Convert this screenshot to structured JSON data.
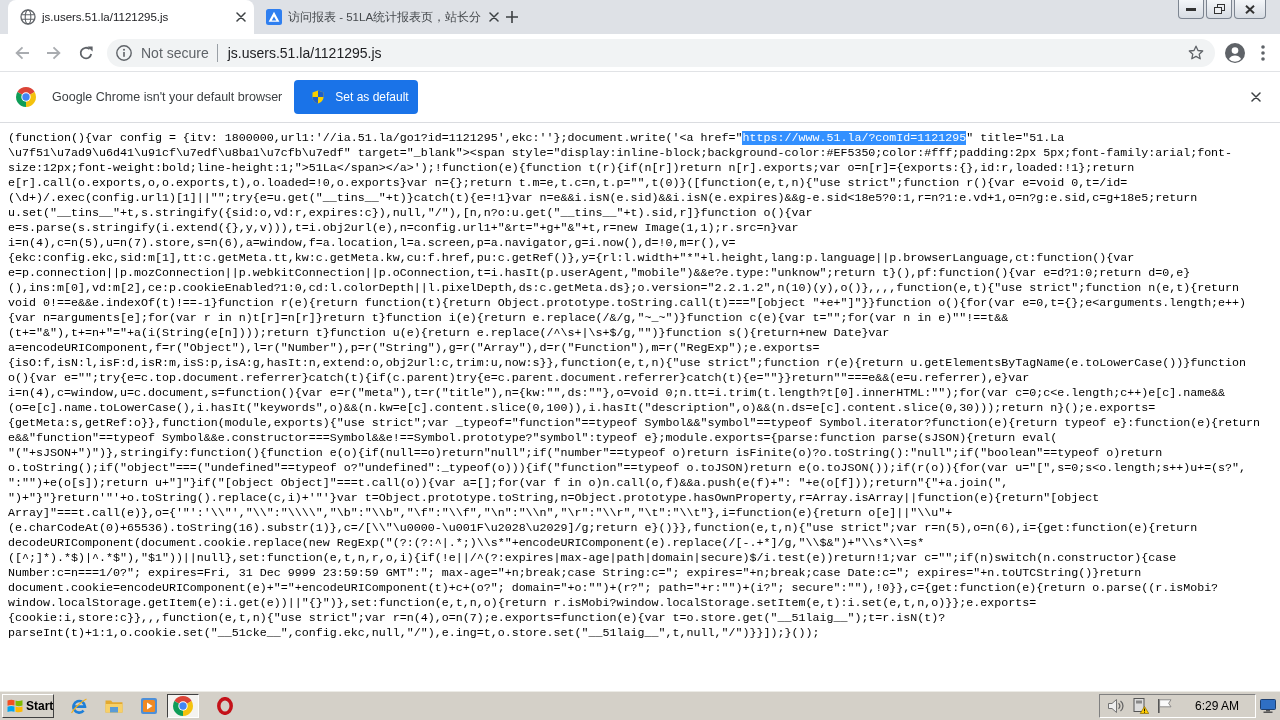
{
  "browser": {
    "tabs": [
      {
        "title": "js.users.51.la/1121295.js",
        "selected": true
      },
      {
        "title": "访问报表 - 51LA统计报表页，站长分",
        "selected": false
      }
    ]
  },
  "toolbar": {
    "security_label": "Not secure",
    "url": "js.users.51.la/1121295.js"
  },
  "infobar": {
    "message": "Google Chrome isn't your default browser",
    "button": "Set as default"
  },
  "document": {
    "lines": [
      {
        "segments": [
          {
            "text": "(function(){var config = {itv: 1800000,url1:'//ia.51.la/go1?id=1121295',ekc:''};document.write('<a href=\"",
            "selected": false
          },
          {
            "text": "https://www.51.la/?comId=1121295",
            "selected": true
          },
          {
            "text": "\" title=\"51.La",
            "selected": false
          }
        ]
      },
      {
        "segments": [
          {
            "text": "\\u7f51\\u7ad9\\u6d41\\u91cf\\u7edf\\u8ba1\\u7cfb\\u7edf\" target=\"_blank\"><span style=\"display:inline-block;background-color:#EF5350;color:#fff;padding:2px 5px;font-family:arial;font-",
            "selected": false
          }
        ]
      },
      {
        "segments": [
          {
            "text": "size:12px;font-weight:bold;line-height:1;\">51La</span></a>');!function(e){function t(r){if(n[r])return n[r].exports;var o=n[r]={exports:{},id:r,loaded:!1};return",
            "selected": false
          }
        ]
      },
      {
        "segments": [
          {
            "text": "e[r].call(o.exports,o,o.exports,t),o.loaded=!0,o.exports}var n={};return t.m=e,t.c=n,t.p=\"\",t(0)}([function(e,t,n){\"use strict\";function r(){var e=void 0,t=/id=",
            "selected": false
          }
        ]
      },
      {
        "segments": [
          {
            "text": "(\\d+)/.exec(config.url1)[1]||\"\";try{e=u.get(\"__tins__\"+t)}catch(t){e=!1}var n=e&&i.isN(e.sid)&&i.isN(e.expires)&&g-e.sid<18e5?0:1,r=n?1:e.vd+1,o=n?g:e.sid,c=g+18e5;return",
            "selected": false
          }
        ]
      },
      {
        "segments": [
          {
            "text": "u.set(\"__tins__\"+t,s.stringify({sid:o,vd:r,expires:c}),null,\"/\"),[n,n?o:u.get(\"__tins__\"+t).sid,r]}function o(){var",
            "selected": false
          }
        ]
      },
      {
        "segments": [
          {
            "text": "e=s.parse(s.stringify(i.extend({},y,v))),t=i.obj2url(e),n=config.url1+\"&rt=\"+g+\"&\"+t,r=new Image(1,1);r.src=n}var",
            "selected": false
          }
        ]
      },
      {
        "segments": [
          {
            "text": "i=n(4),c=n(5),u=n(7).store,s=n(6),a=window,f=a.location,l=a.screen,p=a.navigator,g=i.now(),d=!0,m=r(),v=",
            "selected": false
          }
        ]
      },
      {
        "segments": [
          {
            "text": "{ekc:config.ekc,sid:m[1],tt:c.getMeta.tt,kw:c.getMeta.kw,cu:f.href,pu:c.getRef()},y={rl:l.width+\"*\"+l.height,lang:p.language||p.browserLanguage,ct:function(){var",
            "selected": false
          }
        ]
      },
      {
        "segments": [
          {
            "text": "e=p.connection||p.mozConnection||p.webkitConnection||p.oConnection,t=i.hasIt(p.userAgent,\"mobile\")&&e?e.type:\"unknow\";return t}(),pf:function(){var e=d?1:0;return d=0,e}",
            "selected": false
          }
        ]
      },
      {
        "segments": [
          {
            "text": "(),ins:m[0],vd:m[2],ce:p.cookieEnabled?1:0,cd:l.colorDepth||l.pixelDepth,ds:c.getMeta.ds};o.version=\"2.2.1.2\",n(10)(y),o()},,,,function(e,t){\"use strict\";function n(e,t){return",
            "selected": false
          }
        ]
      },
      {
        "segments": [
          {
            "text": "void 0!==e&&e.indexOf(t)!==-1}function r(e){return function(t){return Object.prototype.toString.call(t)===\"[object \"+e+\"]\"}}function o(){for(var e=0,t={};e<arguments.length;e++)",
            "selected": false
          }
        ]
      },
      {
        "segments": [
          {
            "text": "{var n=arguments[e];for(var r in n)t[r]=n[r]}return t}function i(e){return e.replace(/&/g,\"~_~\")}function c(e){var t=\"\";for(var n in e)\"\"!==t&&",
            "selected": false
          }
        ]
      },
      {
        "segments": [
          {
            "text": "(t+=\"&\"),t+=n+\"=\"+a(i(String(e[n])));return t}function u(e){return e.replace(/^\\s+|\\s+$/g,\"\")}function s(){return+new Date}var",
            "selected": false
          }
        ]
      },
      {
        "segments": [
          {
            "text": "a=encodeURIComponent,f=r(\"Object\"),l=r(\"Number\"),p=r(\"String\"),g=r(\"Array\"),d=r(\"Function\"),m=r(\"RegExp\");e.exports=",
            "selected": false
          }
        ]
      },
      {
        "segments": [
          {
            "text": "{isO:f,isN:l,isF:d,isR:m,isS:p,isA:g,hasIt:n,extend:o,obj2url:c,trim:u,now:s}},function(e,t,n){\"use strict\";function r(e){return u.getElementsByTagName(e.toLowerCase())}function",
            "selected": false
          }
        ]
      },
      {
        "segments": [
          {
            "text": "o(){var e=\"\";try{e=c.top.document.referrer}catch(t){if(c.parent)try{e=c.parent.document.referrer}catch(t){e=\"\"}}return\"\"===e&&(e=u.referrer),e}var",
            "selected": false
          }
        ]
      },
      {
        "segments": [
          {
            "text": "i=n(4),c=window,u=c.document,s=function(){var e=r(\"meta\"),t=r(\"title\"),n={kw:\"\",ds:\"\"},o=void 0;n.tt=i.trim(t.length?t[0].innerHTML:\"\");for(var c=0;c<e.length;c++)e[c].name&&",
            "selected": false
          }
        ]
      },
      {
        "segments": [
          {
            "text": "(o=e[c].name.toLowerCase(),i.hasIt(\"keywords\",o)&&(n.kw=e[c].content.slice(0,100)),i.hasIt(\"description\",o)&&(n.ds=e[c].content.slice(0,30)));return n}();e.exports=",
            "selected": false
          }
        ]
      },
      {
        "segments": [
          {
            "text": "{getMeta:s,getRef:o}},function(module,exports){\"use strict\";var _typeof=\"function\"==typeof Symbol&&\"symbol\"==typeof Symbol.iterator?function(e){return typeof e}:function(e){return",
            "selected": false
          }
        ]
      },
      {
        "segments": [
          {
            "text": "e&&\"function\"==typeof Symbol&&e.constructor===Symbol&&e!==Symbol.prototype?\"symbol\":typeof e};module.exports={parse:function parse(sJSON){return eval(",
            "selected": false
          }
        ]
      },
      {
        "segments": [
          {
            "text": "\"(\"+sJSON+\")\")},stringify:function(){function e(o){if(null==o)return\"null\";if(\"number\"==typeof o)return isFinite(o)?o.toString():\"null\";if(\"boolean\"==typeof o)return",
            "selected": false
          }
        ]
      },
      {
        "segments": [
          {
            "text": "o.toString();if(\"object\"===(\"undefined\"==typeof o?\"undefined\":_typeof(o))){if(\"function\"==typeof o.toJSON)return e(o.toJSON());if(r(o)){for(var u=\"[\",s=0;s<o.length;s++)u+=(s?\",",
            "selected": false
          }
        ]
      },
      {
        "segments": [
          {
            "text": "\":\"\")+e(o[s]);return u+\"]\"}if(\"[object Object]\"===t.call(o)){var a=[];for(var f in o)n.call(o,f)&&a.push(e(f)+\": \"+e(o[f]));return\"{\"+a.join(\",",
            "selected": false
          }
        ]
      },
      {
        "segments": [
          {
            "text": "\")+\"}\"}return'\"'+o.toString().replace(c,i)+'\"'}var t=Object.prototype.toString,n=Object.prototype.hasOwnProperty,r=Array.isArray||function(e){return\"[object",
            "selected": false
          }
        ]
      },
      {
        "segments": [
          {
            "text": "Array]\"===t.call(e)},o={'\"':'\\\\\"',\"\\\\\":\"\\\\\\\\\",\"\\b\":\"\\\\b\",\"\\f\":\"\\\\f\",\"\\n\":\"\\\\n\",\"\\r\":\"\\\\r\",\"\\t\":\"\\\\t\"},i=function(e){return o[e]||\"\\\\u\"+",
            "selected": false
          }
        ]
      },
      {
        "segments": [
          {
            "text": "(e.charCodeAt(0)+65536).toString(16).substr(1)},c=/[\\\\\"\\u0000-\\u001F\\u2028\\u2029]/g;return e}()}},function(e,t,n){\"use strict\";var r=n(5),o=n(6),i={get:function(e){return",
            "selected": false
          }
        ]
      },
      {
        "segments": [
          {
            "text": "decodeURIComponent(document.cookie.replace(new RegExp(\"(?:(?:^|.*;)\\\\s*\"+encodeURIComponent(e).replace(/[-.+*]/g,\"\\\\$&\")+\"\\\\s*\\\\=s*",
            "selected": false
          }
        ]
      },
      {
        "segments": [
          {
            "text": "([^;]*).*$)|^.*$\"),\"$1\"))||null},set:function(e,t,n,r,o,i){if(!e||/^(?:expires|max-age|path|domain|secure)$/i.test(e))return!1;var c=\"\";if(n)switch(n.constructor){case",
            "selected": false
          }
        ]
      },
      {
        "segments": [
          {
            "text": "Number:c=n===1/0?\"; expires=Fri, 31 Dec 9999 23:59:59 GMT\":\"; max-age=\"+n;break;case String:c=\"; expires=\"+n;break;case Date:c=\"; expires=\"+n.toUTCString()}return",
            "selected": false
          }
        ]
      },
      {
        "segments": [
          {
            "text": "document.cookie=encodeURIComponent(e)+\"=\"+encodeURIComponent(t)+c+(o?\"; domain=\"+o:\"\")+(r?\"; path=\"+r:\"\")+(i?\"; secure\":\"\"),!0}},c={get:function(e){return o.parse((r.isMobi?",
            "selected": false
          }
        ]
      },
      {
        "segments": [
          {
            "text": "window.localStorage.getItem(e):i.get(e))||\"{}\")},set:function(e,t,n,o){return r.isMobi?window.localStorage.setItem(e,t):i.set(e,t,n,o)}};e.exports=",
            "selected": false
          }
        ]
      },
      {
        "segments": [
          {
            "text": "{cookie:i,store:c}},,,function(e,t,n){\"use strict\";var r=n(4),o=n(7);e.exports=function(e){var t=o.store.get(\"__51laig__\");t=r.isN(t)?",
            "selected": false
          }
        ]
      },
      {
        "segments": [
          {
            "text": "parseInt(t)+1:1,o.cookie.set(\"__51cke__\",config.ekc,null,\"/\"),e.ing=t,o.store.set(\"__51laig__\",t,null,\"/\")}}]);}());",
            "selected": false
          }
        ]
      }
    ]
  },
  "taskbar": {
    "start_button": "Start",
    "clock": "6:29 AM"
  }
}
